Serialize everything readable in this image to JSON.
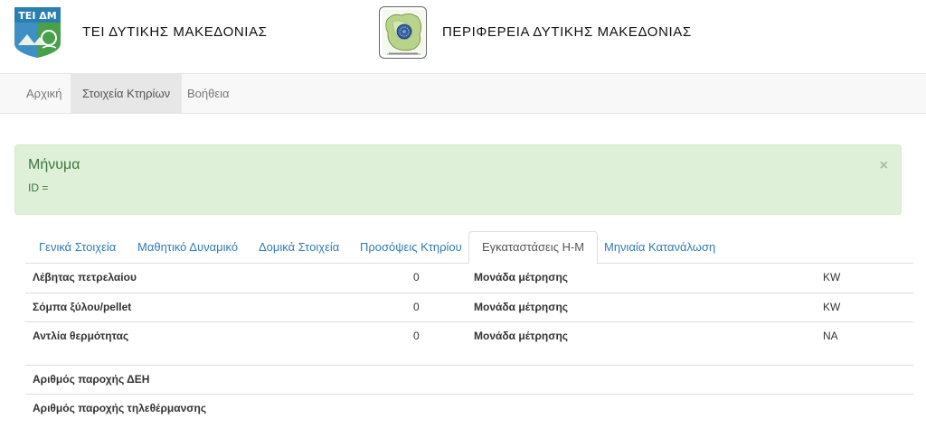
{
  "header": {
    "tei_logo_text": "ΤΕΙ ΔΜ",
    "tei_title": "ΤΕΙ ΔΥΤΙΚΗΣ ΜΑΚΕΔΟΝΙΑΣ",
    "region_title": "ΠΕΡΙΦΕΡΕΙΑ ΔΥΤΙΚΗΣ ΜΑΚΕΔΟΝΙΑΣ",
    "region_logo_icon": "region-map-emblem-icon"
  },
  "nav": {
    "items": [
      {
        "label": "Αρχική"
      },
      {
        "label": "Στοιχεία Κτηρίων",
        "active": true
      },
      {
        "label": "Βοήθεια"
      }
    ]
  },
  "alert": {
    "title": "Μήνυμα",
    "body": "ID =",
    "close": "×",
    "color": "#3c763d",
    "background": "#dff0d8"
  },
  "tabs": [
    {
      "label": "Γενικά Στοιχεία"
    },
    {
      "label": "Μαθητικό Δυναμικό"
    },
    {
      "label": "Δομικά Στοιχεία"
    },
    {
      "label": "Προσόψεις Κτηρίου"
    },
    {
      "label": "Εγκαταστάσεις Η-Μ",
      "active": true
    },
    {
      "label": "Μηνιαία Κατανάλωση"
    }
  ],
  "installations": [
    {
      "name": "Λέβητας πετρελαίου",
      "value": "0",
      "unit_label": "Μονάδα μέτρησης",
      "unit": "KW"
    },
    {
      "name": "Σόμπα ξύλου/pellet",
      "value": "0",
      "unit_label": "Μονάδα μέτρησης",
      "unit": "KW"
    },
    {
      "name": "Αντλία θερμότητας",
      "value": "0",
      "unit_label": "Μονάδα μέτρησης",
      "unit": "NA"
    }
  ],
  "supply": [
    {
      "label": "Αριθμός παροχής ΔΕΗ"
    },
    {
      "label": "Αριθμός παροχής τηλεθέρμανσης"
    }
  ],
  "colors": {
    "link": "#337ab7",
    "nav_bg": "#f8f8f8",
    "nav_active_bg": "#e7e7e7"
  }
}
